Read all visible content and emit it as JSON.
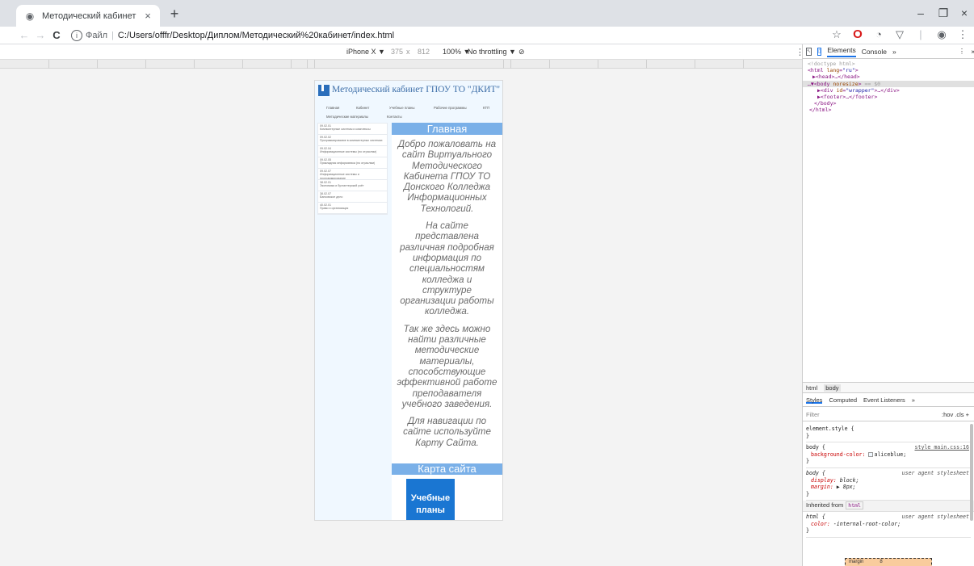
{
  "browser": {
    "tab": {
      "title": "Методический кабинет",
      "close": "×",
      "favicon": "globe-icon"
    },
    "new_tab": "+",
    "window_controls": {
      "minimize": "–",
      "maximize": "❐",
      "close": "×"
    },
    "nav": {
      "back": "←",
      "forward": "→",
      "reload": "C"
    },
    "address": {
      "info": "i",
      "scheme_label": "Файл",
      "separator": "|",
      "url": "C:/Users/offfr/Desktop/Диплом/Методический%20кабинет/index.html"
    },
    "toolbar_icons": [
      "star-icon",
      "opera-icon",
      "extension-icon",
      "shield-icon",
      "account-icon",
      "menu-icon"
    ]
  },
  "device_toolbar": {
    "device": "iPhone X ▼",
    "width": "375",
    "times": "x",
    "height": "812",
    "zoom": "100% ▼",
    "throttling": "No throttling ▼",
    "rotate_icon": "rotate-icon",
    "more": "⋮"
  },
  "site": {
    "title": "Методический кабинет ГПОУ ТО \"ДКИТ\"",
    "nav": [
      "Главная",
      "Кабинет",
      "Учебные планы",
      "Рабочие программы",
      "КТП",
      "Методические материалы",
      "Контакты"
    ],
    "sidebar": [
      {
        "code": "09.02.01",
        "name": "Компьютерные системы и комплексы"
      },
      {
        "code": "09.02.02",
        "name": "Программирование в компьютерных системах"
      },
      {
        "code": "09.02.04",
        "name": "Информационные системы (по отраслям)"
      },
      {
        "code": "09.02.05",
        "name": "Прикладная информатика (по отраслям)"
      },
      {
        "code": "09.02.07",
        "name": "Информационные системы и программирование"
      },
      {
        "code": "38.02.01",
        "name": "Экономика и бухгалтерский учёт"
      },
      {
        "code": "38.02.07",
        "name": "Банковское дело"
      },
      {
        "code": "40.02.01",
        "name": "Право и организация"
      }
    ],
    "main_title": "Главная",
    "paragraphs": [
      "Добро пожаловать на сайт Виртуального Методического Кабинета ГПОУ ТО Донского Колледжа Информационных Технологий.",
      "На сайте представлена различная подробная информация по специальностям колледжа и структуре организации работы колледжа.",
      "Так же здесь можно найти различные методические материалы, способствующие эффективной работе преподавателя учебного заведения.",
      "Для навигации по сайте используйте Карту Сайта."
    ],
    "sitemap_title": "Карта сайта",
    "tile_label": "Учебные планы"
  },
  "devtools": {
    "tabs": {
      "elements": "Elements",
      "console": "Console",
      "more": "»",
      "menu": "⋮",
      "close": "×"
    },
    "dom": {
      "doctype": "<!doctype html>",
      "html_open_tag": "<html",
      "lang_attr": "lang",
      "lang_value": "\"ru\"",
      "head": "▶<head>…</head>",
      "body_open_tag": "…▼<body",
      "noresize": "noresize",
      "selected_marker": "== $0",
      "div_open": "▶<div",
      "id_attr": "id",
      "id_value": "\"wrapper\"",
      "div_close": ">…</div>",
      "footer": "▶<footer>…</footer>",
      "body_close": "</body>",
      "html_close": "</html>"
    },
    "breadcrumbs": [
      "html",
      "body"
    ],
    "subtabs": [
      "Styles",
      "Computed",
      "Event Listeners",
      "»"
    ],
    "filter": {
      "placeholder": "Filter",
      "right": ":hov  .cls  +"
    },
    "styles": {
      "element_style": "element.style {",
      "close": "}",
      "body_rule": "body {",
      "body_src": "style main.css:16",
      "bg_prop": "background-color:",
      "bg_val": "aliceblue;",
      "ua_body": "body {",
      "ua_src": "user agent stylesheet",
      "display_prop": "display:",
      "display_val": "block;",
      "margin_prop": "margin:",
      "margin_val": "▶ 8px;",
      "inherited_label": "Inherited from",
      "inherited_tag": "html",
      "html_rule": "html {",
      "html_src": "user agent stylesheet",
      "color_prop": "color:",
      "color_val": "-internal-root-color;"
    },
    "boxmodel": {
      "label": "margin",
      "value": "8"
    }
  },
  "colors": {
    "site_bg": "#f0f8ff",
    "section_header": "#7ab0e8",
    "tile": "#1a76d2",
    "logo": "#2a6ebb",
    "title_text": "#3d6ea8"
  }
}
